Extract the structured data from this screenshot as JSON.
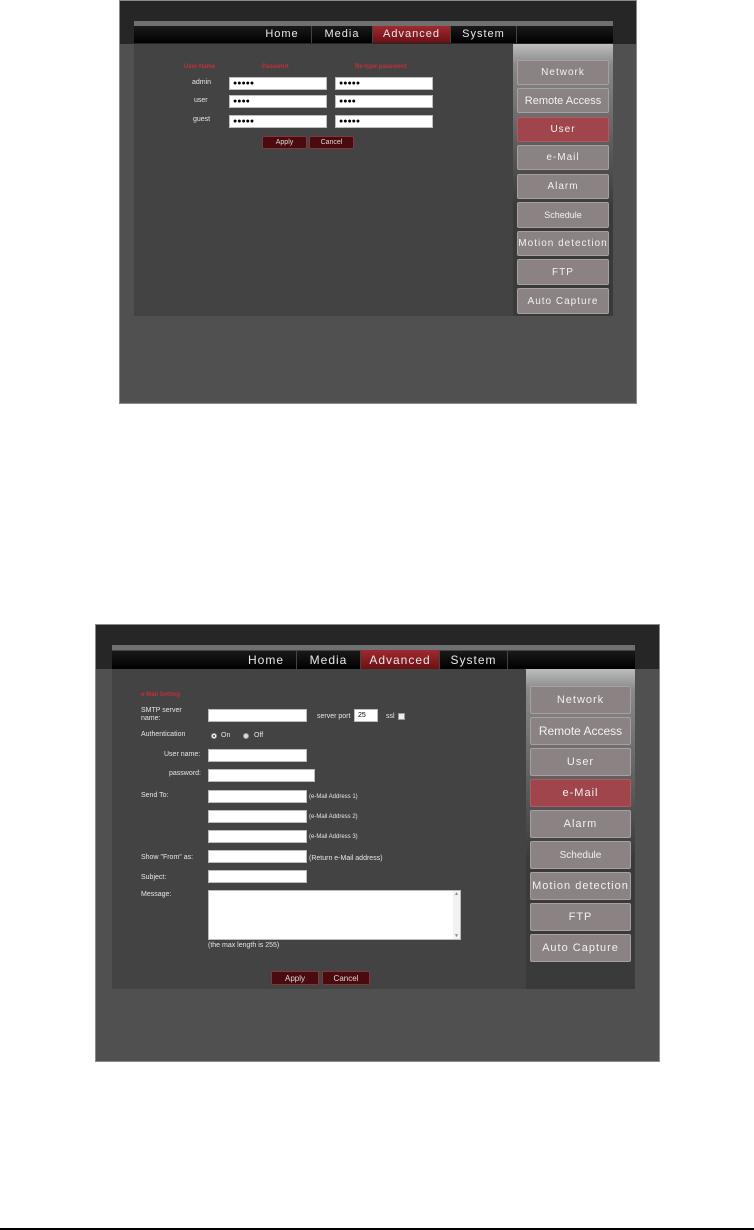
{
  "nav": {
    "items": [
      "Home",
      "Media",
      "Advanced",
      "System"
    ],
    "active": "Advanced"
  },
  "sidebar_items": [
    "Network",
    "Remote Access",
    "User",
    "e-Mail",
    "Alarm",
    "Schedule",
    "Motion detection",
    "FTP",
    "Auto Capture"
  ],
  "screen1": {
    "active_sidebar": "User",
    "headers": {
      "user_name": "User Name",
      "password": "Passwort",
      "retype": "Re-type password"
    },
    "rows": [
      {
        "user": "admin",
        "password": "●●●●●",
        "retype": "●●●●●"
      },
      {
        "user": "user",
        "password": "●●●●",
        "retype": "●●●●"
      },
      {
        "user": "guest",
        "password": "●●●●●",
        "retype": "●●●●●"
      }
    ],
    "apply_label": "Apply",
    "cancel_label": "Cancel"
  },
  "screen2": {
    "active_sidebar": "e-Mail",
    "section_title": "e-Mail Setting",
    "smtp_label": "SMTP server name:",
    "smtp_value": "",
    "server_port_label": "server port",
    "server_port_value": "25",
    "ssl_label": "ssl",
    "ssl_checked": false,
    "auth_label": "Authentication",
    "auth_options": [
      "On",
      "Off"
    ],
    "auth_selected": "On",
    "username_label": "User name:",
    "username_value": "",
    "password_label": "password:",
    "password_value": "",
    "send_to_label": "Send To:",
    "send_to": [
      {
        "value": "",
        "hint": "(e-Mail Address 1)"
      },
      {
        "value": "",
        "hint": "(e-Mail Address 2)"
      },
      {
        "value": "",
        "hint": "(e-Mail Address 3)"
      }
    ],
    "from_label": "Show \"From\" as:",
    "from_value": "",
    "from_hint": "(Return e-Mail address)",
    "subject_label": "Subject:",
    "subject_value": "",
    "message_label": "Message:",
    "message_value": "",
    "max_length_note": "(the max length is 255)",
    "apply_label": "Apply",
    "cancel_label": "Cancel"
  }
}
